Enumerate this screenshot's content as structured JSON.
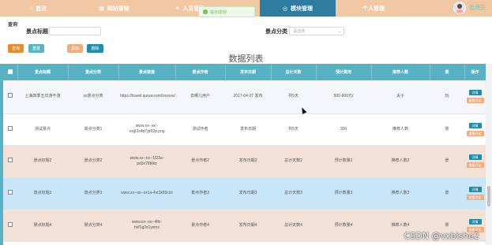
{
  "nav": {
    "items": [
      {
        "icon": "home-icon",
        "label": "首页"
      },
      {
        "icon": "grid-icon",
        "label": "网站管理"
      },
      {
        "icon": "person-icon",
        "label": "人员管理"
      },
      {
        "icon": "module-icon",
        "label": "模块管理"
      },
      {
        "icon": "",
        "label": "个人管理"
      }
    ],
    "active_index": 3,
    "user_name": "管理员"
  },
  "toast": {
    "text": "提示成功!"
  },
  "search": {
    "crumb": "查询",
    "title_label": "景点标题",
    "title_value": "",
    "category_label": "景点分类",
    "category_placeholder": "请选择",
    "search_label": "查询",
    "reset_label": "重置",
    "add_label": "添加",
    "delete_label": "删除"
  },
  "list_title": "数据列表",
  "table": {
    "columns": [
      "景点标题",
      "景点分类",
      "景点链接",
      "景点作者",
      "发布日期",
      "总计天数",
      "预计费用",
      "推荐人数",
      "景",
      "操作"
    ],
    "rows": [
      [
        "上海四季五日游不游",
        "xx景点分类",
        "https://travel.qunar.com/xxxxxx/xxx15281",
        "去哪儿用户",
        "2017-04-27 发布",
        "共5天",
        "500-600元/",
        "夫子",
        "玩"
      ],
      [
        "测试景点",
        "景点分类1",
        "www.xx--xx--xxgl3x4q7gr82p.png",
        "测试作者",
        "发布日期",
        "共5天",
        "300",
        "推荐人数",
        "景"
      ],
      [
        "景点标题2",
        "景点分类2",
        "www.xx--xx--1f23a-pd3x78bbiz",
        "景点作者2",
        "发布日期2",
        "总计天数2",
        "预计数量2",
        "推荐人数2",
        "景"
      ],
      [
        "景点标题3",
        "景点分类3",
        "www.xx--xx--xx1a-4xt1k83cxx",
        "景点作者3",
        "发布日期3",
        "总计天数3",
        "预计数量3",
        "推荐人数3",
        "景"
      ],
      [
        "景点标题4",
        "景点分类4",
        "www.xx--xx--4lfx-hsf1g2s1yxmx",
        "景点作者4",
        "发布日期4",
        "总计天数4",
        "预计数量4",
        "推荐人数4",
        "景"
      ]
    ],
    "detail_label": "详情",
    "review_label": "查看评论"
  },
  "watermark": "CSDN @vxbishe2",
  "colors": {
    "nav_bg": "#f2c7a4",
    "nav_active": "#2e7da1",
    "header_bg": "#57b3c4",
    "row_peach": "#f2e1d7",
    "row_blue": "#c9e5f8",
    "btn_orange": "#e98b2e",
    "btn_teal": "#5ab3c5",
    "btn_dark": "#1e8cab"
  }
}
